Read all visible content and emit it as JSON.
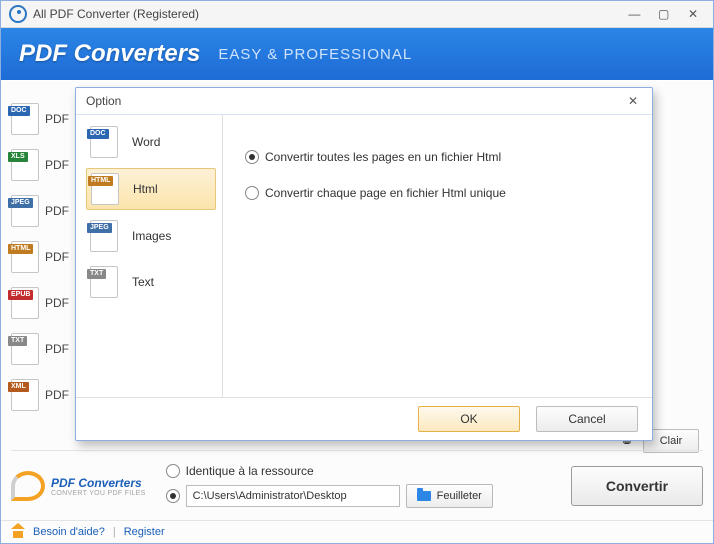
{
  "window": {
    "title": "All PDF Converter (Registered)"
  },
  "banner": {
    "brand": "PDF Converters",
    "subtitle": "EASY & PROFESSIONAL"
  },
  "sidebar_formats": [
    {
      "tag": "DOC",
      "cls": "doc",
      "label": "PDF"
    },
    {
      "tag": "XLS",
      "cls": "xls",
      "label": "PDF"
    },
    {
      "tag": "JPEG",
      "cls": "jpeg",
      "label": "PDF"
    },
    {
      "tag": "HTML",
      "cls": "html",
      "label": "PDF"
    },
    {
      "tag": "EPUB",
      "cls": "epub",
      "label": "PDF"
    },
    {
      "tag": "TXT",
      "cls": "txt",
      "label": "PDF"
    },
    {
      "tag": "XML",
      "cls": "xml",
      "label": "PDF"
    }
  ],
  "clair_label": "Clair",
  "bottom": {
    "brand_top": "PDF Converters",
    "brand_sub": "CONVERT YOU PDF FILES",
    "radio_same": "Identique à la ressource",
    "path": "C:\\Users\\Administrator\\Desktop",
    "browse": "Feuilleter",
    "convert": "Convertir"
  },
  "status": {
    "help": "Besoin d'aide?",
    "register": "Register"
  },
  "dialog": {
    "title": "Option",
    "options": [
      {
        "tag": "DOC",
        "cls": "doc",
        "label": "Word"
      },
      {
        "tag": "HTML",
        "cls": "html",
        "label": "Html"
      },
      {
        "tag": "JPEG",
        "cls": "jpeg",
        "label": "Images"
      },
      {
        "tag": "TXT",
        "cls": "txt",
        "label": "Text"
      }
    ],
    "selected_index": 1,
    "radio_all": "Convertir toutes les pages en un fichier Html",
    "radio_each": "Convertir chaque page en fichier Html unique",
    "ok": "OK",
    "cancel": "Cancel"
  }
}
